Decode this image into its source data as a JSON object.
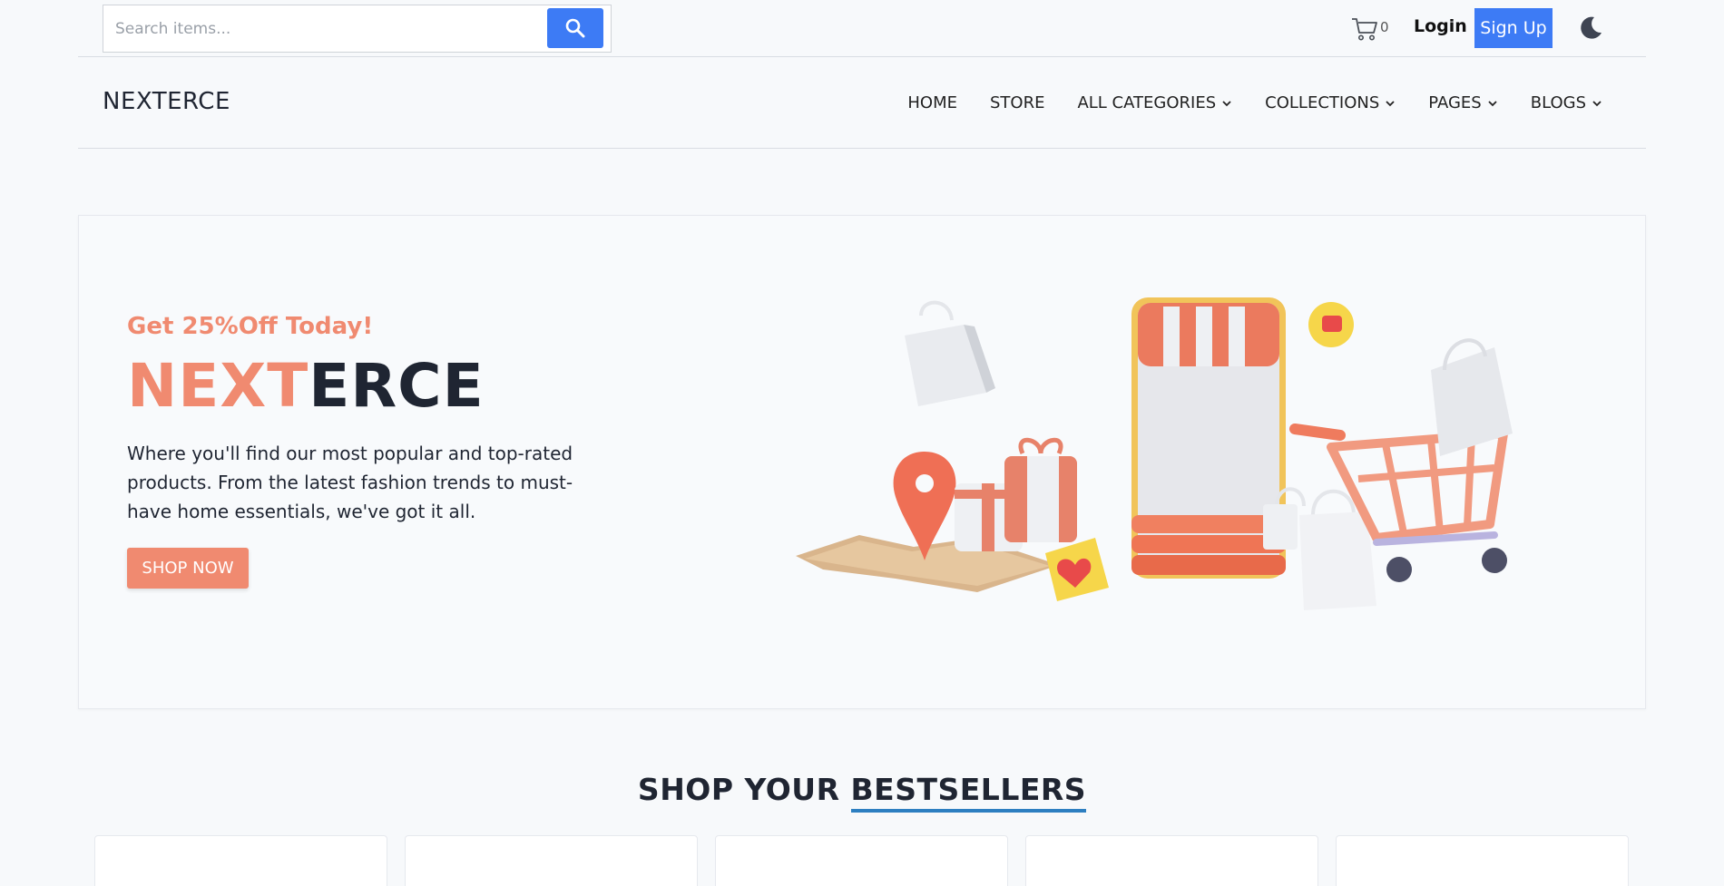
{
  "header": {
    "search": {
      "placeholder": "Search items...",
      "value": ""
    },
    "cart_count": "0",
    "login_label": "Login",
    "signup_label": "Sign Up"
  },
  "nav": {
    "brand": "NEXTERCE",
    "items": [
      {
        "label": "HOME",
        "has_dropdown": false
      },
      {
        "label": "STORE",
        "has_dropdown": false
      },
      {
        "label": "ALL CATEGORIES",
        "has_dropdown": true
      },
      {
        "label": "COLLECTIONS",
        "has_dropdown": true
      },
      {
        "label": "PAGES",
        "has_dropdown": true
      },
      {
        "label": "BLOGS",
        "has_dropdown": true
      }
    ]
  },
  "hero": {
    "promo": "Get 25%Off Today!",
    "title_part1": "NEXT",
    "title_part2": "ERCE",
    "description": "Where you'll find our most popular and top-rated products. From the latest fashion trends to must-have home essentials, we've got it all.",
    "button_label": "SHOP NOW"
  },
  "bestsellers": {
    "title_part1": "SHOP YOUR ",
    "title_part2": "BESTSELLERS",
    "cards": [
      "tshirt-black",
      "blank",
      "tshirt-black",
      "blank",
      "tshirt-black"
    ]
  },
  "colors": {
    "accent_blue": "#3d7bf5",
    "accent_coral": "#f08a70",
    "text_dark": "#1f2532",
    "underline_blue": "#2d7fc1"
  },
  "icons": [
    "search-icon",
    "cart-icon",
    "moon-icon",
    "chevron-down-icon"
  ]
}
